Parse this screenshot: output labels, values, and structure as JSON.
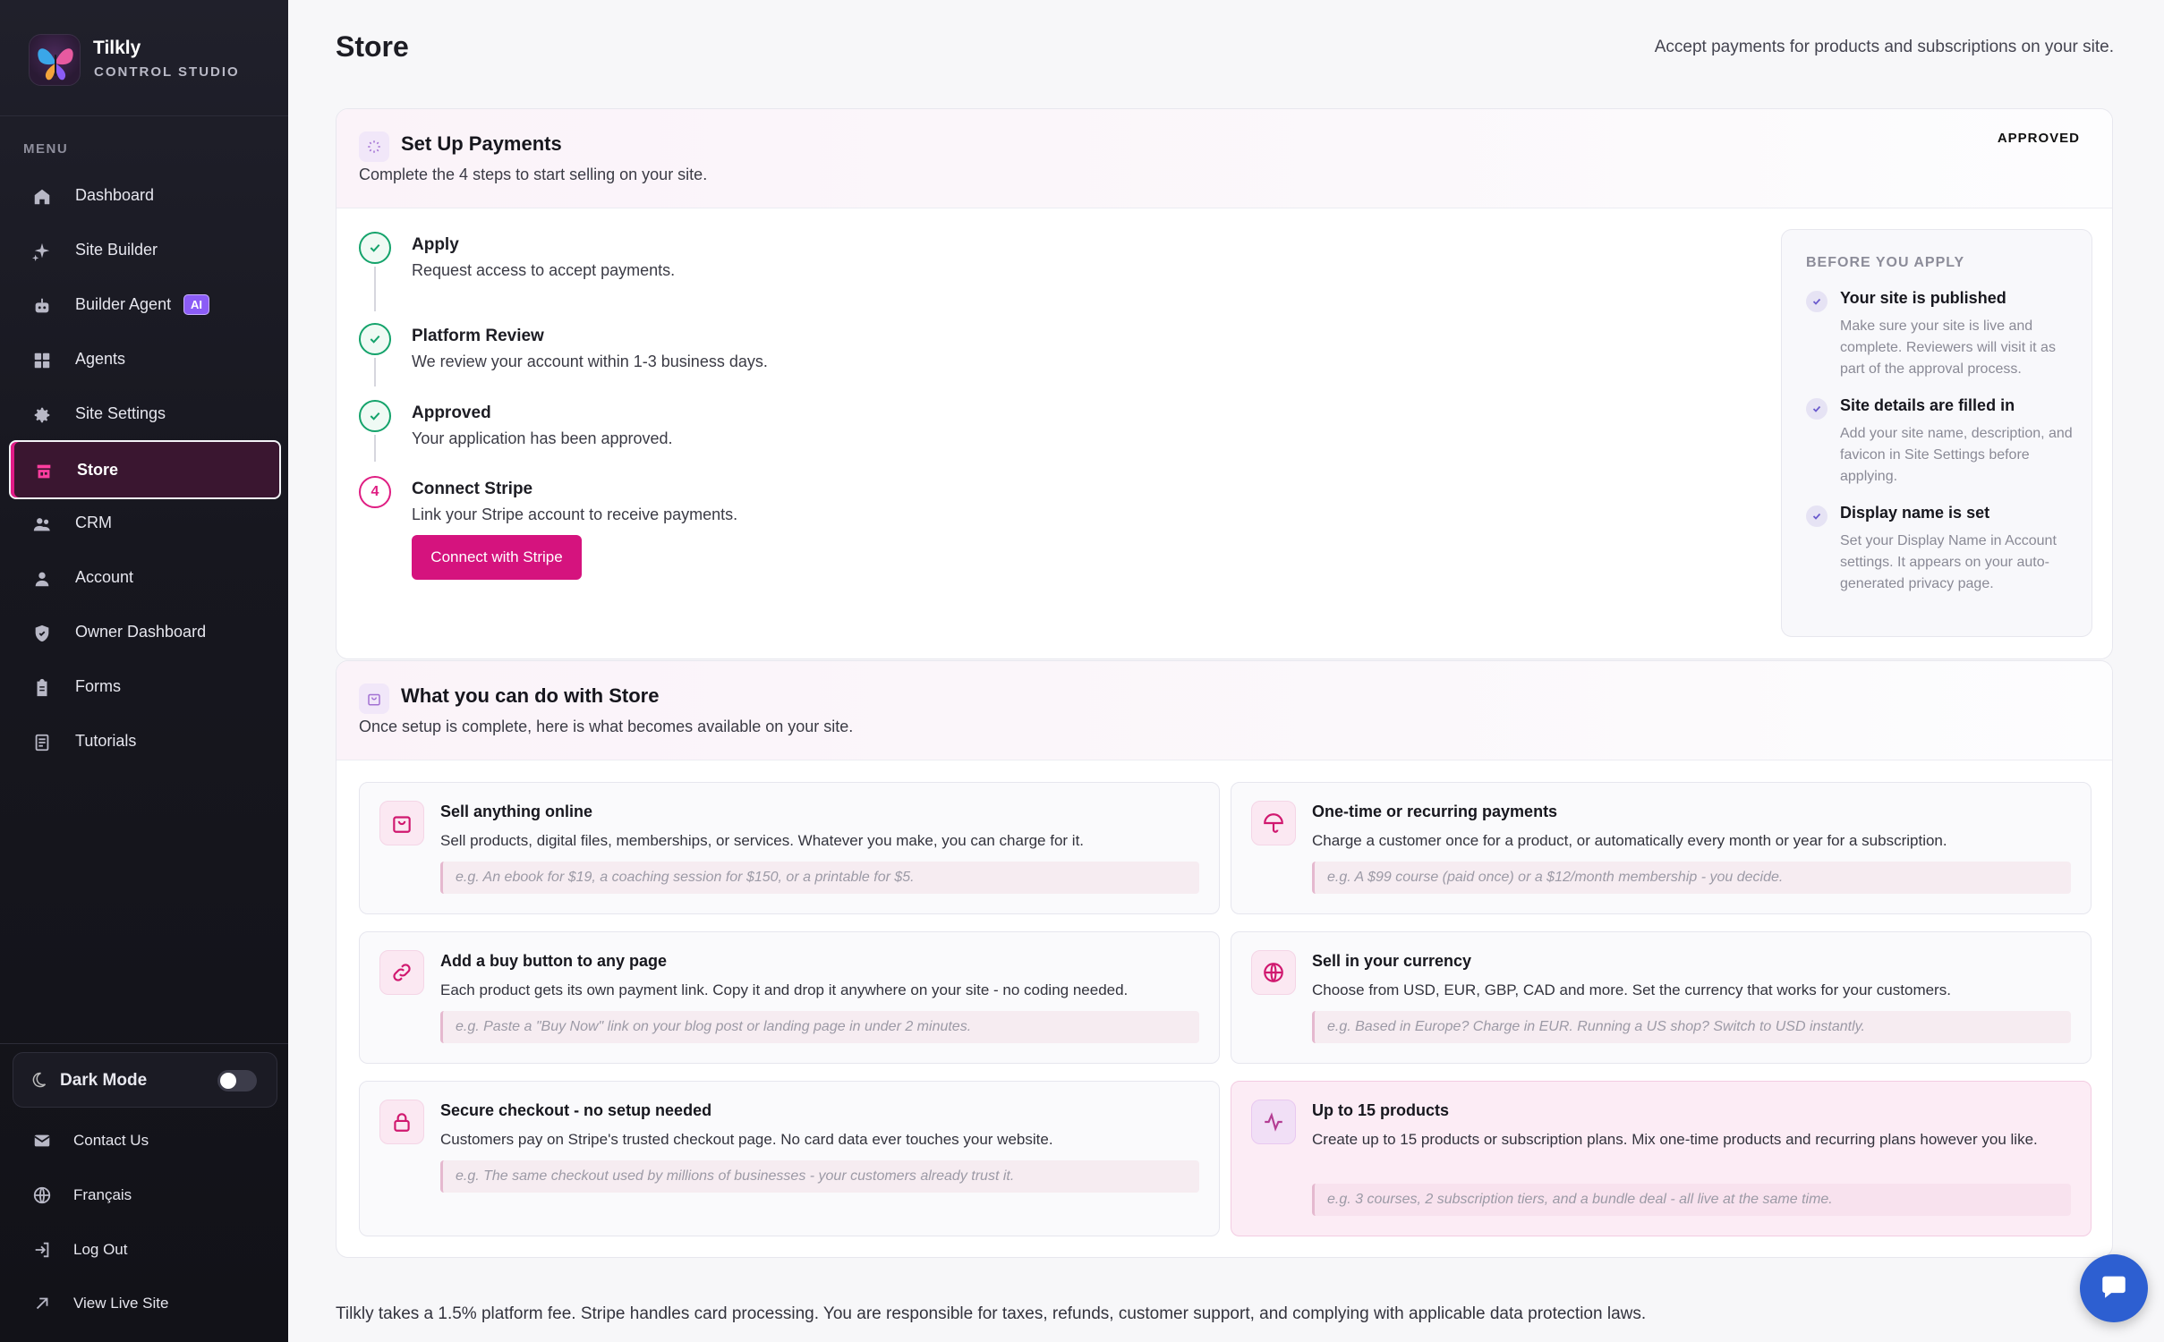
{
  "brand": {
    "name": "Tilkly",
    "subtitle": "CONTROL STUDIO"
  },
  "sidebar": {
    "menu_label": "MENU",
    "items": [
      {
        "label": "Dashboard",
        "icon": "home-icon"
      },
      {
        "label": "Site Builder",
        "icon": "sparkle-icon"
      },
      {
        "label": "Builder Agent",
        "icon": "robot-icon",
        "badge": "AI"
      },
      {
        "label": "Agents",
        "icon": "grid-icon"
      },
      {
        "label": "Site Settings",
        "icon": "gear-icon"
      },
      {
        "label": "Store",
        "icon": "store-icon",
        "active": true
      },
      {
        "label": "CRM",
        "icon": "users-icon"
      },
      {
        "label": "Account",
        "icon": "user-icon"
      },
      {
        "label": "Owner Dashboard",
        "icon": "shield-icon"
      },
      {
        "label": "Forms",
        "icon": "clipboard-icon"
      },
      {
        "label": "Tutorials",
        "icon": "document-icon"
      }
    ],
    "dark_mode": {
      "label": "Dark Mode",
      "enabled": false
    },
    "bottom_items": [
      {
        "label": "Contact Us",
        "icon": "mail-icon"
      },
      {
        "label": "Français",
        "icon": "globe-icon"
      },
      {
        "label": "Log Out",
        "icon": "logout-icon"
      },
      {
        "label": "View Live Site",
        "icon": "external-arrow-icon"
      }
    ]
  },
  "header": {
    "title": "Store",
    "subtitle": "Accept payments for products and subscriptions on your site."
  },
  "setup": {
    "title": "Set Up Payments",
    "subtitle": "Complete the 4 steps to start selling on your site.",
    "status": "APPROVED",
    "steps": [
      {
        "title": "Apply",
        "desc": "Request access to accept payments.",
        "state": "done"
      },
      {
        "title": "Platform Review",
        "desc": "We review your account within 1-3 business days.",
        "state": "done"
      },
      {
        "title": "Approved",
        "desc": "Your application has been approved.",
        "state": "done"
      },
      {
        "title": "Connect Stripe",
        "desc": "Link your Stripe account to receive payments.",
        "state": "current",
        "number": "4"
      }
    ],
    "connect_button": "Connect with Stripe",
    "before": {
      "title": "BEFORE YOU APPLY",
      "items": [
        {
          "title": "Your site is published",
          "desc": "Make sure your site is live and complete. Reviewers will visit it as part of the approval process."
        },
        {
          "title": "Site details are filled in",
          "desc": "Add your site name, description, and favicon in Site Settings before applying."
        },
        {
          "title": "Display name is set",
          "desc": "Set your Display Name in Account settings. It appears on your auto-generated privacy page."
        }
      ]
    }
  },
  "features": {
    "title": "What you can do with Store",
    "subtitle": "Once setup is complete, here is what becomes available on your site.",
    "items": [
      {
        "title": "Sell anything online",
        "desc": "Sell products, digital files, memberships, or services. Whatever you make, you can charge for it.",
        "example": "e.g. An ebook for $19, a coaching session for $150, or a printable for $5.",
        "icon": "shopping-bag-icon"
      },
      {
        "title": "One-time or recurring payments",
        "desc": "Charge a customer once for a product, or automatically every month or year for a subscription.",
        "example": "e.g. A $99 course (paid once) or a $12/month membership - you decide.",
        "icon": "umbrella-icon"
      },
      {
        "title": "Add a buy button to any page",
        "desc": "Each product gets its own payment link. Copy it and drop it anywhere on your site - no coding needed.",
        "example": "e.g. Paste a \"Buy Now\" link on your blog post or landing page in under 2 minutes.",
        "icon": "link-icon"
      },
      {
        "title": "Sell in your currency",
        "desc": "Choose from USD, EUR, GBP, CAD and more. Set the currency that works for your customers.",
        "example": "e.g. Based in Europe? Charge in EUR. Running a US shop? Switch to USD instantly.",
        "icon": "globe-icon"
      },
      {
        "title": "Secure checkout - no setup needed",
        "desc": "Customers pay on Stripe's trusted checkout page. No card data ever touches your website.",
        "example": "e.g. The same checkout used by millions of businesses - your customers already trust it.",
        "icon": "lock-icon"
      },
      {
        "title": "Up to 15 products",
        "desc": "Create up to 15 products or subscription plans. Mix one-time products and recurring plans however you like.",
        "example": "e.g. 3 courses, 2 subscription tiers, and a bundle deal - all live at the same time.",
        "icon": "activity-icon"
      }
    ]
  },
  "footer_note": "Tilkly takes a 1.5% platform fee. Stripe handles card processing. You are responsible for taxes, refunds, customer support, and complying with applicable data protection laws.",
  "colors": {
    "accent": "#d5137e",
    "success": "#14a36b",
    "sidebar_bg": "#17171f",
    "chat": "#2d5fd1"
  }
}
